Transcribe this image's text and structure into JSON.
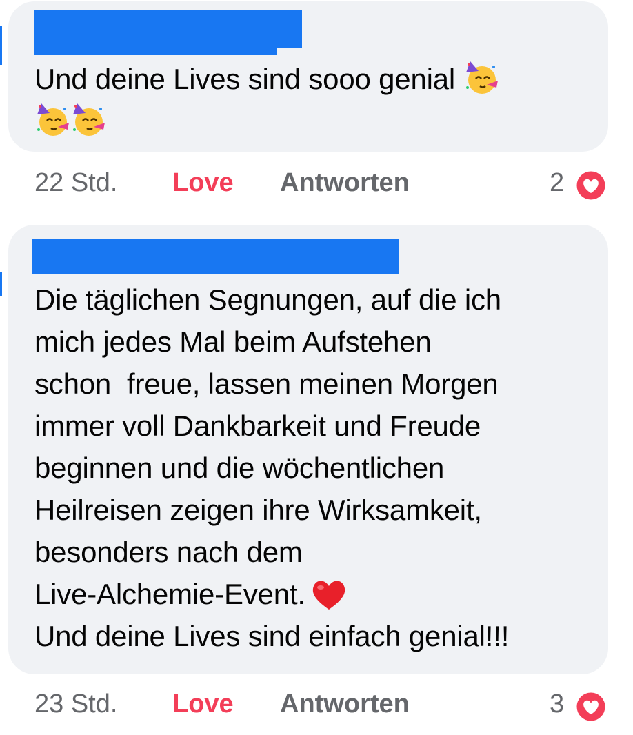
{
  "comments": [
    {
      "text": "Und deine Lives sind sooo genial",
      "emoji": "partying-face-icon",
      "time": "22 Std.",
      "love_label": "Love",
      "reply_label": "Antworten",
      "reaction_count": "2"
    },
    {
      "text": "Die täglichen Segnungen, auf die ich\nmich jedes Mal beim Aufstehen\nschon  freue, lassen meinen Morgen\nimmer voll Dankbarkeit und Freude\nbeginnen und die wöchentlichen\nHeilreisen zeigen ihre Wirksamkeit,\nbesonders nach dem\nLive-Alchemie-Event.",
      "text_last_line": "Und deine Lives sind einfach genial!!!",
      "emoji": "red-heart-icon",
      "time": "23 Std.",
      "love_label": "Love",
      "reply_label": "Antworten",
      "reaction_count": "3"
    }
  ],
  "colors": {
    "bubble": "#f0f2f5",
    "love": "#f33e58",
    "meta": "#65676b",
    "redaction": "#1877f2"
  }
}
